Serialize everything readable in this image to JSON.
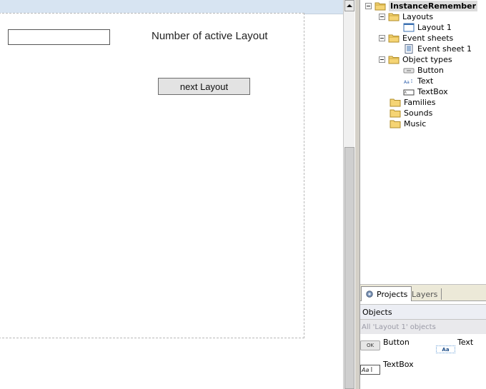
{
  "layout_editor": {
    "text_object": "Number of active Layout",
    "button_object": "next Layout"
  },
  "project_tree": {
    "root": "InstanceRemember",
    "layouts_folder": "Layouts",
    "layout_1": "Layout 1",
    "event_sheets_folder": "Event sheets",
    "event_sheet_1": "Event sheet 1",
    "object_types_folder": "Object types",
    "object_types": [
      "Button",
      "Text",
      "TextBox"
    ],
    "families_folder": "Families",
    "sounds_folder": "Sounds",
    "music_folder": "Music"
  },
  "tabs": {
    "projects": "Projects",
    "layers": "Layers"
  },
  "objects_panel": {
    "title": "Objects",
    "filter": "All 'Layout 1' objects",
    "items": [
      {
        "name": "Button",
        "preview": "OK"
      },
      {
        "name": "Text",
        "preview": "Aa"
      },
      {
        "name": "TextBox",
        "preview": "Aa"
      }
    ]
  },
  "colors": {
    "folder": "#f5d474",
    "selection": "#dcdcdc",
    "editor_strip": "#d7e4f2"
  }
}
